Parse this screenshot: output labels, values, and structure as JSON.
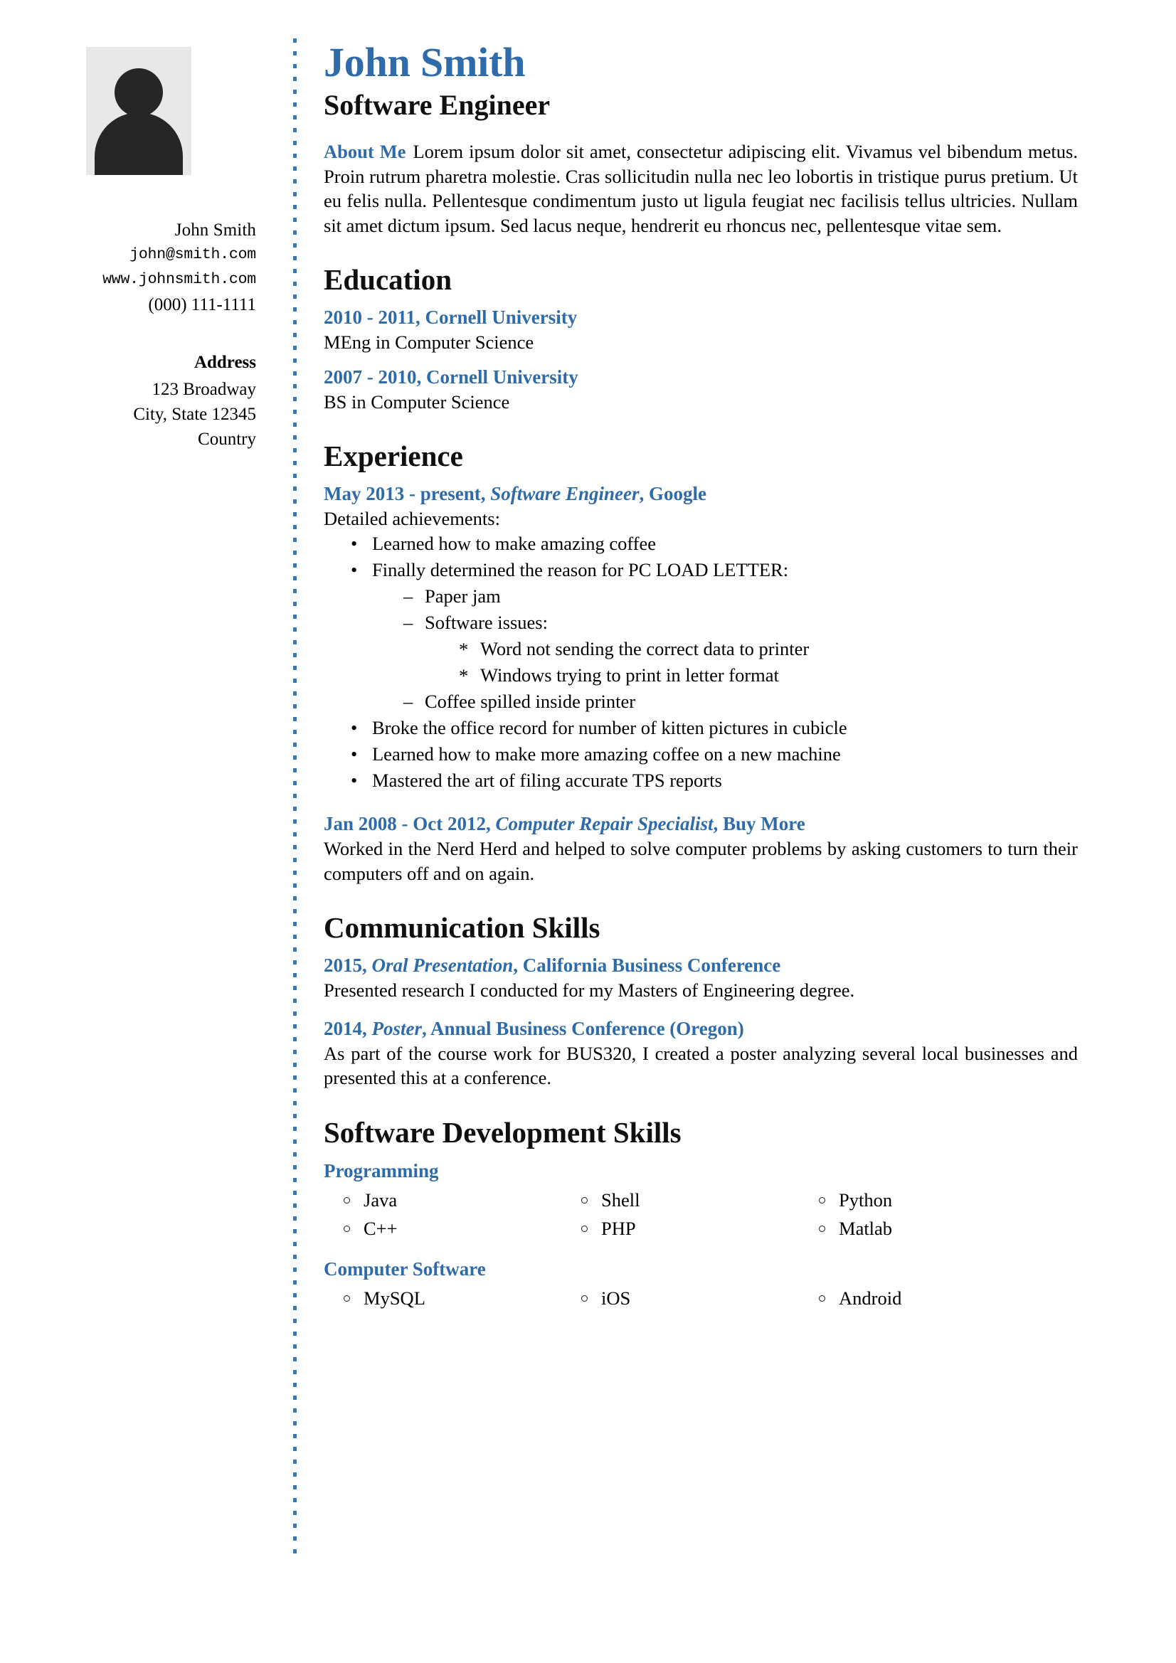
{
  "accent_color": "#2e6ba8",
  "header": {
    "full_name": "John Smith",
    "job_title": "Software Engineer"
  },
  "sidebar": {
    "photo_alt": "user-avatar-placeholder",
    "contact": {
      "name": "John Smith",
      "email": "john@smith.com",
      "website": "www.johnsmith.com",
      "phone": "(000) 111-1111"
    },
    "address": {
      "title": "Address",
      "line1": "123 Broadway",
      "line2": "City, State 12345",
      "line3": "Country"
    }
  },
  "about": {
    "label": "About Me",
    "text": "Lorem ipsum dolor sit amet, consectetur adipiscing elit. Vivamus vel bibendum metus. Proin rutrum pharetra molestie. Cras sollicitudin nulla nec leo lobortis in tristique purus pretium. Ut eu felis nulla. Pellentesque condimentum justo ut ligula feugiat nec facilisis tellus ultricies. Nullam sit amet dictum ipsum. Sed lacus neque, hendrerit eu rhoncus nec, pellentesque vitae sem."
  },
  "sections": {
    "education": {
      "heading": "Education",
      "entries": [
        {
          "head": "2010 - 2011, Cornell University",
          "sub": "MEng in Computer Science"
        },
        {
          "head": "2007 - 2010, Cornell University",
          "sub": "BS in Computer Science"
        }
      ]
    },
    "experience": {
      "heading": "Experience",
      "job1": {
        "dates": "May 2013 - present,",
        "role": "Software Engineer",
        "company": ", Google",
        "intro": "Detailed achievements:",
        "b1": "Learned how to make amazing coffee",
        "b2": "Finally determined the reason for PC LOAD LETTER:",
        "b2a": "Paper jam",
        "b2b": "Software issues:",
        "b2b1": "Word not sending the correct data to printer",
        "b2b2": "Windows trying to print in letter format",
        "b2c": "Coffee spilled inside printer",
        "b3": "Broke the office record for number of kitten pictures in cubicle",
        "b4": "Learned how to make more amazing coffee on a new machine",
        "b5": "Mastered the art of filing accurate TPS reports"
      },
      "job2": {
        "dates": "Jan 2008 - Oct 2012,",
        "role": "Computer Repair Specialist",
        "company": ", Buy More",
        "desc": "Worked in the Nerd Herd and helped to solve computer problems by asking customers to turn their computers off and on again."
      }
    },
    "communication": {
      "heading": "Communication Skills",
      "entries": [
        {
          "year": "2015,",
          "role": "Oral Presentation",
          "venue": ", California Business Conference",
          "desc": "Presented research I conducted for my Masters of Engineering degree."
        },
        {
          "year": "2014,",
          "role": "Poster",
          "venue": ", Annual Business Conference (Oregon)",
          "desc": "As part of the course work for BUS320, I created a poster analyzing several local businesses and presented this at a conference."
        }
      ]
    },
    "software_skills": {
      "heading": "Software Development Skills",
      "groups": [
        {
          "category": "Programming",
          "items": [
            "Java",
            "Shell",
            "Python",
            "C++",
            "PHP",
            "Matlab"
          ]
        },
        {
          "category": "Computer Software",
          "items": [
            "MySQL",
            "iOS",
            "Android"
          ]
        }
      ]
    }
  },
  "markers": {
    "bullet": "•",
    "dash": "–",
    "star": "*"
  }
}
